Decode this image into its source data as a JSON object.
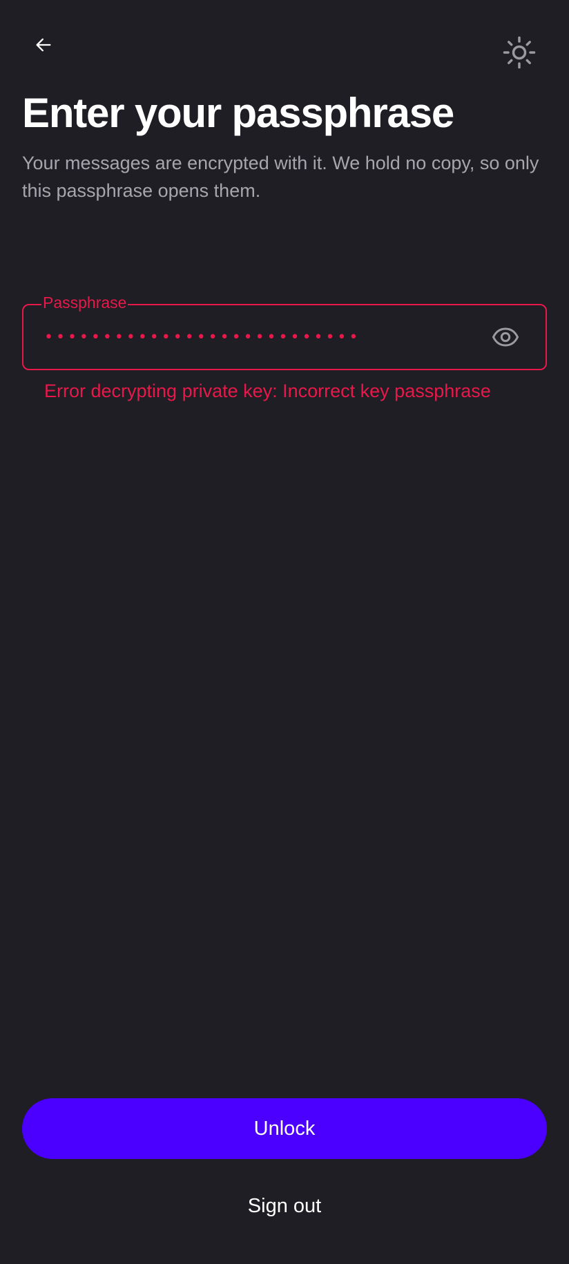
{
  "header": {
    "back_icon": "arrow-left-icon",
    "theme_icon": "sun-icon"
  },
  "title": "Enter your passphrase",
  "subtitle": "Your messages are encrypted with it. We hold no copy, so only this passphrase opens them.",
  "passphrase_field": {
    "label": "Passphrase",
    "masked_value": "•••••••••••••••••••••••••••",
    "visibility_icon": "eye-icon",
    "state": "error"
  },
  "error_message": "Error decrypting private key: Incorrect key passphrase",
  "actions": {
    "unlock_label": "Unlock",
    "signout_label": "Sign out"
  },
  "colors": {
    "background": "#1f1e24",
    "error": "#e8194a",
    "primary": "#4b00ff",
    "text_primary": "#ffffff",
    "text_secondary": "#a7a6ad"
  }
}
